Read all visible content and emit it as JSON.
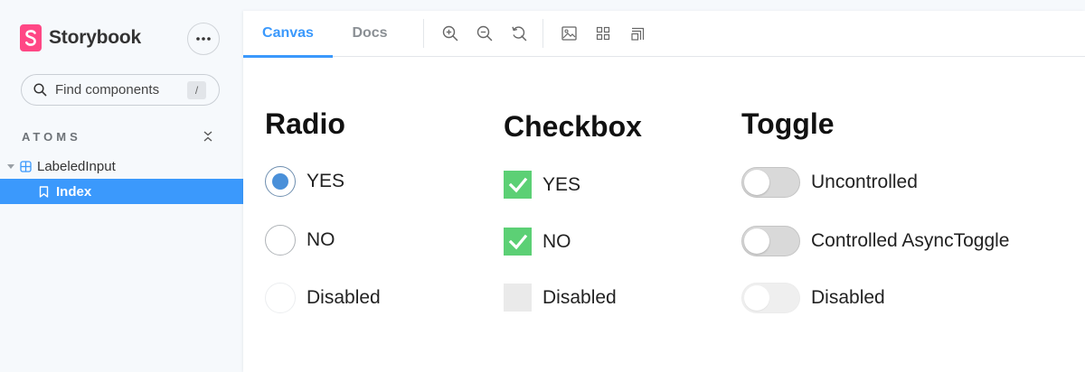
{
  "sidebar": {
    "brand": {
      "name": "Storybook",
      "logo_letter": "S",
      "logo_color": "#ff4785"
    },
    "search": {
      "placeholder": "Find components",
      "shortcut": "/"
    },
    "section": {
      "label": "ATOMS"
    },
    "tree": {
      "component": {
        "label": "LabeledInput",
        "icon": "component-icon"
      },
      "story": {
        "label": "Index",
        "icon": "bookmark-icon",
        "selected": true
      }
    },
    "accent_color": "#3b99fc"
  },
  "toolbar": {
    "tabs": [
      {
        "label": "Canvas",
        "active": true
      },
      {
        "label": "Docs",
        "active": false
      }
    ],
    "buttons": [
      "zoom-in-icon",
      "zoom-out-icon",
      "zoom-reset-icon",
      "background-icon",
      "grid-icon",
      "outline-icon"
    ]
  },
  "canvas": {
    "radio": {
      "title": "Radio",
      "options": [
        {
          "label": "YES",
          "state": "checked"
        },
        {
          "label": "NO",
          "state": "unchecked"
        },
        {
          "label": "Disabled",
          "state": "disabled"
        }
      ]
    },
    "checkbox": {
      "title": "Checkbox",
      "options": [
        {
          "label": "YES",
          "state": "checked"
        },
        {
          "label": "NO",
          "state": "checked"
        },
        {
          "label": "Disabled",
          "state": "disabled"
        }
      ],
      "checked_color": "#5cd075"
    },
    "toggle": {
      "title": "Toggle",
      "options": [
        {
          "label": "Uncontrolled",
          "state": "off"
        },
        {
          "label": "Controlled AsyncToggle",
          "state": "off"
        },
        {
          "label": "Disabled",
          "state": "disabled"
        }
      ]
    }
  }
}
